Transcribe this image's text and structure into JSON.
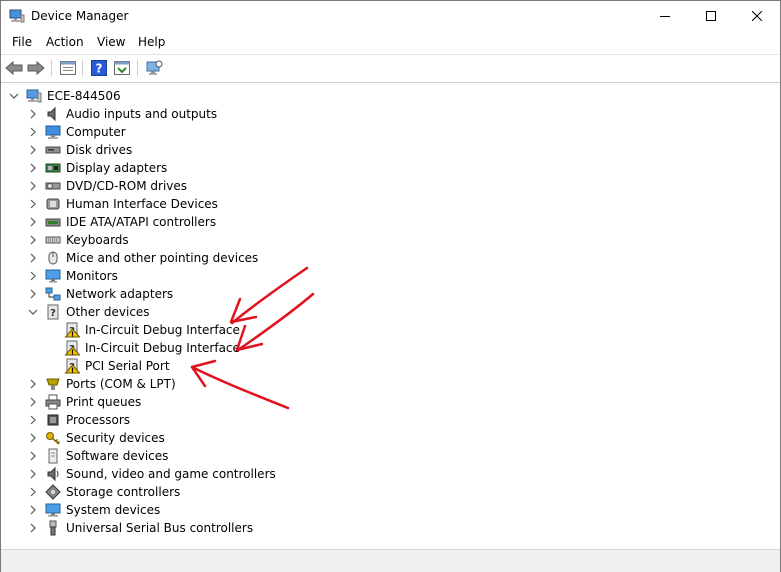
{
  "window": {
    "title": "Device Manager",
    "controls": {
      "minimize": "minimize",
      "maximize": "maximize",
      "close": "close"
    }
  },
  "menu": {
    "items": [
      "File",
      "Action",
      "View",
      "Help"
    ]
  },
  "toolbar": {
    "icons": [
      "back-arrow-icon",
      "forward-arrow-icon",
      "properties-icon",
      "help-icon",
      "update-driver-icon",
      "scan-hardware-icon"
    ]
  },
  "tree": {
    "root": "ECE-844506",
    "categories": [
      {
        "label": "Audio inputs and outputs",
        "icon": "speaker-icon"
      },
      {
        "label": "Computer",
        "icon": "computer-icon"
      },
      {
        "label": "Disk drives",
        "icon": "disk-drive-icon"
      },
      {
        "label": "Display adapters",
        "icon": "display-adapter-icon"
      },
      {
        "label": "DVD/CD-ROM drives",
        "icon": "dvd-drive-icon"
      },
      {
        "label": "Human Interface Devices",
        "icon": "hid-icon"
      },
      {
        "label": "IDE ATA/ATAPI controllers",
        "icon": "ide-controller-icon"
      },
      {
        "label": "Keyboards",
        "icon": "keyboard-icon"
      },
      {
        "label": "Mice and other pointing devices",
        "icon": "mouse-icon"
      },
      {
        "label": "Monitors",
        "icon": "monitor-icon"
      },
      {
        "label": "Network adapters",
        "icon": "network-adapter-icon"
      },
      {
        "label": "Other devices",
        "icon": "other-devices-icon",
        "expanded": true,
        "children": [
          "In-Circuit Debug Interface",
          "In-Circuit Debug Interface",
          "PCI Serial Port"
        ]
      },
      {
        "label": "Ports (COM & LPT)",
        "icon": "ports-icon"
      },
      {
        "label": "Print queues",
        "icon": "printer-icon"
      },
      {
        "label": "Processors",
        "icon": "processor-icon"
      },
      {
        "label": "Security devices",
        "icon": "security-key-icon"
      },
      {
        "label": "Software devices",
        "icon": "software-device-icon"
      },
      {
        "label": "Sound, video and game controllers",
        "icon": "sound-icon"
      },
      {
        "label": "Storage controllers",
        "icon": "storage-controller-icon"
      },
      {
        "label": "System devices",
        "icon": "system-device-icon"
      },
      {
        "label": "Universal Serial Bus controllers",
        "icon": "usb-icon"
      }
    ]
  },
  "colors": {
    "annotation_arrow": "#e0121e",
    "warning": "#f2c200"
  }
}
